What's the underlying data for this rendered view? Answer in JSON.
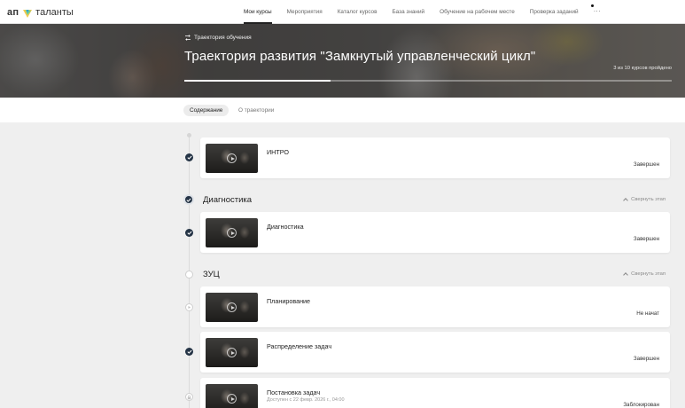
{
  "app": {
    "logo_prefix": "ап",
    "logo_name": "таланты"
  },
  "nav": {
    "items": [
      {
        "label": "Мои курсы",
        "active": true
      },
      {
        "label": "Мероприятия",
        "active": false
      },
      {
        "label": "Каталог курсов",
        "active": false
      },
      {
        "label": "База знаний",
        "active": false
      },
      {
        "label": "Обучение на рабочем месте",
        "active": false
      },
      {
        "label": "Проверка заданий",
        "active": false
      }
    ],
    "more": "···"
  },
  "hero": {
    "tag": "Траектория обучения",
    "title": "Траектория развития \"Замкнутый управленческий цикл\"",
    "progress_text": "3 из 10 курсов пройдено",
    "progress_fraction": 0.3
  },
  "tabs": [
    {
      "label": "Содержание",
      "active": true
    },
    {
      "label": "О траектории",
      "active": false
    }
  ],
  "stages": [
    {
      "title": "Диагностика",
      "collapse_label": "Свернуть этап"
    },
    {
      "title": "ЗУЦ",
      "collapse_label": "Свернуть этап"
    }
  ],
  "courses": [
    {
      "title": "ИНТРО",
      "subtitle": "",
      "status": "Завершен",
      "state": "done"
    },
    {
      "title": "Диагностика",
      "subtitle": "",
      "status": "Завершен",
      "state": "done"
    },
    {
      "title": "Планирование",
      "subtitle": "",
      "status": "Не начат",
      "state": "not-started"
    },
    {
      "title": "Распределение задач",
      "subtitle": "",
      "status": "Завершен",
      "state": "done"
    },
    {
      "title": "Постановка задач",
      "subtitle": "Доступен с 22 февр. 2026 г., 04:00",
      "status": "Заблокирован",
      "state": "locked"
    }
  ],
  "colors": {
    "node_done": "#253446",
    "background": "#efefef",
    "card": "#ffffff"
  },
  "icons": [
    "route-icon",
    "check-icon",
    "play-icon",
    "lock-icon",
    "chevron-up-icon"
  ]
}
